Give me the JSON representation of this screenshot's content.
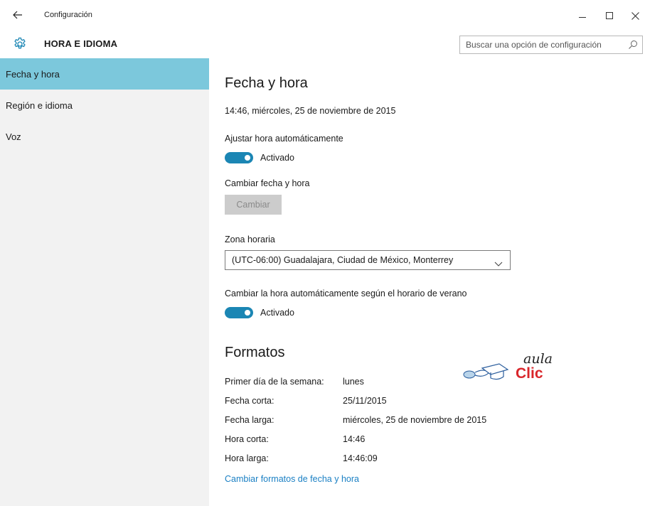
{
  "window": {
    "title": "Configuración",
    "back_icon": "back-arrow-icon",
    "controls": [
      "minimize-icon",
      "maximize-icon",
      "close-icon"
    ]
  },
  "header": {
    "icon": "gear-icon",
    "title": "HORA E IDIOMA",
    "search_placeholder": "Buscar una opción de configuración",
    "search_icon": "search-icon"
  },
  "sidebar": {
    "items": [
      {
        "label": "Fecha y hora",
        "active": true
      },
      {
        "label": "Región e idioma",
        "active": false
      },
      {
        "label": "Voz",
        "active": false
      }
    ]
  },
  "main": {
    "title": "Fecha y hora",
    "current_datetime": "14:46, miércoles, 25 de noviembre de 2015",
    "auto_time": {
      "label": "Ajustar hora automáticamente",
      "state": "Activado",
      "on": true
    },
    "change_datetime": {
      "label": "Cambiar fecha y hora",
      "button": "Cambiar",
      "enabled": false
    },
    "timezone": {
      "label": "Zona horaria",
      "value": "(UTC-06:00) Guadalajara, Ciudad de México, Monterrey"
    },
    "dst": {
      "label": "Cambiar la hora automáticamente según el horario de verano",
      "state": "Activado",
      "on": true
    },
    "formats": {
      "title": "Formatos",
      "rows": [
        {
          "label": "Primer día de la semana:",
          "value": "lunes"
        },
        {
          "label": "Fecha corta:",
          "value": "25/11/2015"
        },
        {
          "label": "Fecha larga:",
          "value": "miércoles, 25 de noviembre de 2015"
        },
        {
          "label": "Hora corta:",
          "value": "14:46"
        },
        {
          "label": "Hora larga:",
          "value": "14:46:09"
        }
      ],
      "link": "Cambiar formatos de fecha y hora"
    }
  },
  "watermark": {
    "line1": "aula",
    "line2": "Clic"
  },
  "colors": {
    "accent": "#1b86b4",
    "sidebar_active": "#7cc8dc",
    "sidebar_bg": "#f2f2f2",
    "link": "#1b80c4",
    "logo_red": "#d9262b",
    "logo_blue": "#2d5f9e"
  }
}
